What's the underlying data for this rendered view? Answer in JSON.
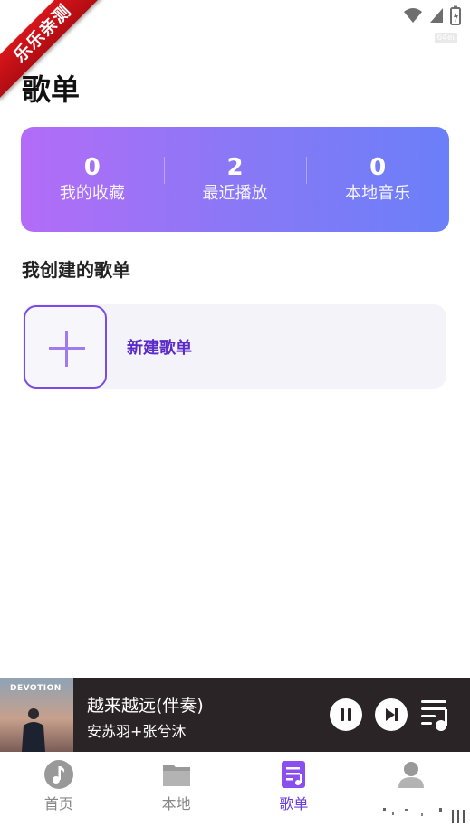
{
  "status_bar": {
    "ribbon_text": "乐乐亲测",
    "tag": "64ei",
    "icons": [
      "wifi-icon",
      "signal-icon",
      "battery-icon"
    ]
  },
  "page": {
    "title": "歌单"
  },
  "stats": [
    {
      "value": "0",
      "label": "我的收藏"
    },
    {
      "value": "2",
      "label": "最近播放"
    },
    {
      "value": "0",
      "label": "本地音乐"
    }
  ],
  "my_playlists": {
    "section_title": "我创建的歌单",
    "new_playlist_label": "新建歌单"
  },
  "player": {
    "cover_title": "DEVOTION",
    "track_title": "越来越远(伴奏)",
    "artist": "安苏羽+张兮沐",
    "state": "playing"
  },
  "nav": [
    {
      "label": "首页",
      "icon": "music-note-icon",
      "active": false
    },
    {
      "label": "本地",
      "icon": "folder-icon",
      "active": false
    },
    {
      "label": "歌单",
      "icon": "playlist-icon",
      "active": true
    },
    {
      "label": "",
      "icon": "user-icon",
      "active": false
    }
  ],
  "colors": {
    "accent": "#6a3ddf",
    "card_gradient_start": "#b36cf7",
    "card_gradient_end": "#6b7ff8",
    "player_bg": "#2b2426"
  }
}
